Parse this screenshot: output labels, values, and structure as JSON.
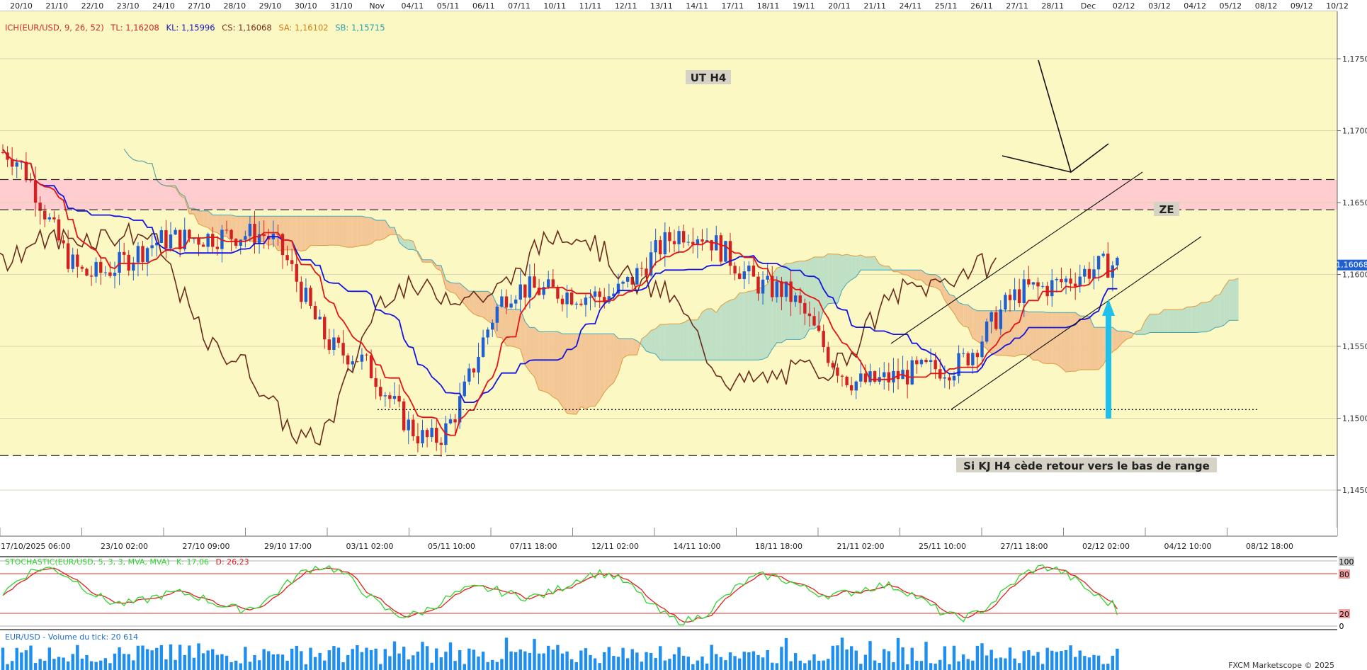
{
  "chart_data": {
    "type": "candlestick",
    "top_dates": [
      "20/10",
      "21/10",
      "22/10",
      "23/10",
      "24/10",
      "27/10",
      "28/10",
      "29/10",
      "30/10",
      "31/10",
      "Nov",
      "04/11",
      "05/11",
      "06/11",
      "07/11",
      "10/11",
      "11/11",
      "12/11",
      "13/11",
      "14/11",
      "17/11",
      "18/11",
      "19/11",
      "20/11",
      "21/11",
      "24/11",
      "25/11",
      "26/11",
      "27/11",
      "28/11",
      "Dec",
      "02/12",
      "03/12",
      "04/12",
      "05/12",
      "08/12",
      "09/12",
      "10/12"
    ],
    "x_labels": [
      "17/10/2025 06:00",
      "23/10 02:00",
      "27/10 09:00",
      "29/10 17:00",
      "03/11 02:00",
      "05/11 10:00",
      "07/11 18:00",
      "12/11 02:00",
      "14/11 10:00",
      "18/11 18:00",
      "21/11 02:00",
      "25/11 10:00",
      "27/11 18:00",
      "02/12 02:00",
      "04/12 10:00",
      "08/12 18:00"
    ],
    "y_ticks": [
      "1,1750",
      "1,1700",
      "1,1650",
      "1,1600",
      "1,1550",
      "1,1500",
      "1,1450"
    ],
    "y_tick_values": [
      1.175,
      1.17,
      1.165,
      1.16,
      1.155,
      1.15,
      1.145
    ],
    "ylim": [
      1.1418,
      1.1783
    ],
    "last_price_label": "1,16068",
    "last_price": 1.16068,
    "indicator_header": {
      "name": "ICH(EUR/USD, 9, 26, 52)",
      "tl": "TL: 1,16208",
      "kl": "KL: 1,15996",
      "cs": "CS: 1,16068",
      "sa": "SA: 1,16102",
      "sb": "SB: 1,15715"
    },
    "annotations": {
      "timeframe": "UT H4",
      "zone": "ZE",
      "scenario": "Si KJ H4 cède retour vers le bas de range"
    },
    "levels": {
      "ze_top": 1.1666,
      "ze_bottom": 1.1645,
      "range_low": 1.1474,
      "dotted_support": 1.1506
    },
    "key_points": [
      {
        "x": "17/10/2025 06:00",
        "close": 1.1685
      },
      {
        "x": "23/10 02:00",
        "close": 1.16
      },
      {
        "x": "27/10 09:00",
        "close": 1.1625
      },
      {
        "x": "29/10 17:00",
        "close": 1.1628
      },
      {
        "x": "03/11 02:00",
        "close": 1.1545
      },
      {
        "x": "05/11 10:00",
        "close": 1.1485
      },
      {
        "x": "07/11 18:00",
        "close": 1.159
      },
      {
        "x": "12/11 02:00",
        "close": 1.1585
      },
      {
        "x": "14/11 10:00",
        "close": 1.163
      },
      {
        "x": "18/11 18:00",
        "close": 1.159
      },
      {
        "x": "21/11 02:00",
        "close": 1.1525
      },
      {
        "x": "25/11 10:00",
        "close": 1.1535
      },
      {
        "x": "27/11 18:00",
        "close": 1.159
      },
      {
        "x": "02/12 02:00",
        "close": 1.1607
      }
    ],
    "stochastic": {
      "label": "STOCHASTIC(EUR/USD, 5, 3, 3, MVA, MVA)",
      "k": "K: 17,06",
      "d": "D: 26,23",
      "ticks": [
        "100",
        "80",
        "20",
        "0"
      ],
      "levels": [
        80,
        20
      ]
    },
    "volume": {
      "label": "EUR/USD - Volume du tick: 20 614"
    },
    "watermark": "FXCM Marketscope © 2025",
    "colors": {
      "background": "#fcf8c4",
      "bull": "#1f5fd1",
      "bear": "#d42020",
      "tenkan": "#e41414",
      "kijun": "#1414e0",
      "chikou": "#6b2a1c",
      "kumo_bear": "#f4c896",
      "kumo_bull": "#bfe0c4",
      "ze_zone": "#ffcccf",
      "arrow": "#1ec0ec",
      "stoch_k": "#2ed52e",
      "stoch_d": "#e02020",
      "volume": "#1e8ef0"
    }
  }
}
